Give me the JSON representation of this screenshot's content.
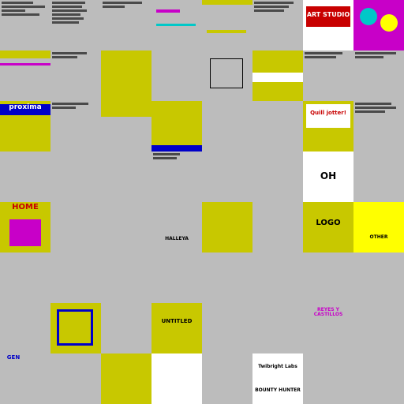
{
  "colors": {
    "gray": "#bcbcbc",
    "yellow": "#c8c800",
    "bright_yellow": "#ffff00",
    "blue": "#0000c8",
    "red": "#c80000",
    "magenta": "#c800c8",
    "cyan": "#00c8c8",
    "green": "#00c800",
    "black": "#000000",
    "white": "#ffffff"
  },
  "titles": {
    "art_studio": "ART STUDIO",
    "proxima": "proxima",
    "quill_jotter": "Quill jotter!",
    "home": "HOME",
    "logo": "LOGO",
    "halley": "HALLEYA",
    "untitled": "UNTITLED",
    "reyes": "REYES Y CASTILLOS",
    "twibright": "Twibright Labs",
    "bounty": "BOUNTY HUNTER",
    "gen": "GEN",
    "other": "OTHER",
    "oh": "OH"
  }
}
